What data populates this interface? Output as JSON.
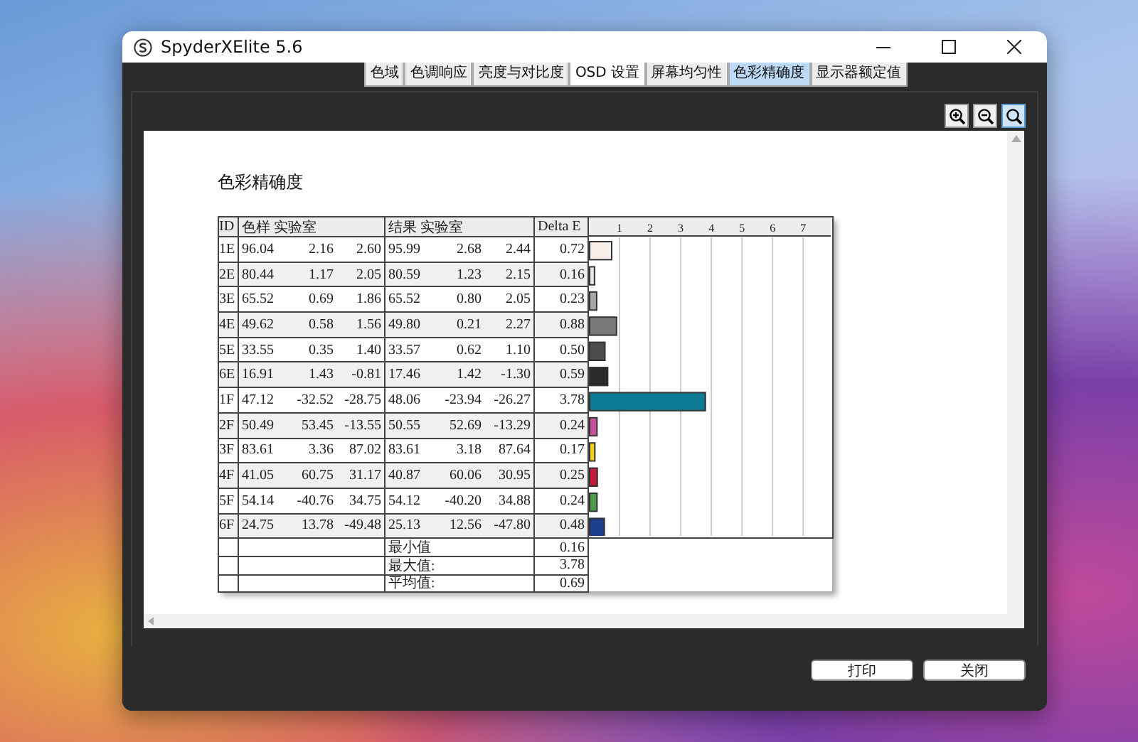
{
  "window": {
    "title": "SpyderXElite 5.6"
  },
  "tabs": [
    {
      "label": "色域",
      "selected": false,
      "hovered": false
    },
    {
      "label": "色调响应",
      "selected": false,
      "hovered": false
    },
    {
      "label": "亮度与对比度",
      "selected": false,
      "hovered": false
    },
    {
      "label": "OSD 设置",
      "selected": false,
      "hovered": true
    },
    {
      "label": "屏幕均匀性",
      "selected": false,
      "hovered": false
    },
    {
      "label": "色彩精确度",
      "selected": true,
      "hovered": false
    },
    {
      "label": "显示器额定值",
      "selected": false,
      "hovered": false
    }
  ],
  "zoom_tools": [
    {
      "kind": "zoom-in",
      "selected": false
    },
    {
      "kind": "zoom-out",
      "selected": false
    },
    {
      "kind": "zoom-fit",
      "selected": true
    }
  ],
  "report": {
    "title": "色彩精确度",
    "columns": [
      "ID",
      "色样 实验室",
      "结果 实验室",
      "Delta E"
    ],
    "rows": [
      {
        "id": "1E",
        "sample": [
          "96.04",
          "2.16",
          "2.60"
        ],
        "result": [
          "95.99",
          "2.68",
          "2.44"
        ],
        "delta_e": "0.72",
        "color": "#f8eeea"
      },
      {
        "id": "2E",
        "sample": [
          "80.44",
          "1.17",
          "2.05"
        ],
        "result": [
          "80.59",
          "1.23",
          "2.15"
        ],
        "delta_e": "0.16",
        "color": "#e6e6e6"
      },
      {
        "id": "3E",
        "sample": [
          "65.52",
          "0.69",
          "1.86"
        ],
        "result": [
          "65.52",
          "0.80",
          "2.05"
        ],
        "delta_e": "0.23",
        "color": "#a9a7a4"
      },
      {
        "id": "4E",
        "sample": [
          "49.62",
          "0.58",
          "1.56"
        ],
        "result": [
          "49.80",
          "0.21",
          "2.27"
        ],
        "delta_e": "0.88",
        "color": "#7a7977"
      },
      {
        "id": "5E",
        "sample": [
          "33.55",
          "0.35",
          "1.40"
        ],
        "result": [
          "33.57",
          "0.62",
          "1.10"
        ],
        "delta_e": "0.50",
        "color": "#4d4c4c"
      },
      {
        "id": "6E",
        "sample": [
          "16.91",
          "1.43",
          "-0.81"
        ],
        "result": [
          "17.46",
          "1.42",
          "-1.30"
        ],
        "delta_e": "0.59",
        "color": "#2b2b2c"
      },
      {
        "id": "1F",
        "sample": [
          "47.12",
          "-32.52",
          "-28.75"
        ],
        "result": [
          "48.06",
          "-23.94",
          "-26.27"
        ],
        "delta_e": "3.78",
        "color": "#0f7c96"
      },
      {
        "id": "2F",
        "sample": [
          "50.49",
          "53.45",
          "-13.55"
        ],
        "result": [
          "50.55",
          "52.69",
          "-13.29"
        ],
        "delta_e": "0.24",
        "color": "#c94f9c"
      },
      {
        "id": "3F",
        "sample": [
          "83.61",
          "3.36",
          "87.02"
        ],
        "result": [
          "83.61",
          "3.18",
          "87.64"
        ],
        "delta_e": "0.17",
        "color": "#f2d21e"
      },
      {
        "id": "4F",
        "sample": [
          "41.05",
          "60.75",
          "31.17"
        ],
        "result": [
          "40.87",
          "60.06",
          "30.95"
        ],
        "delta_e": "0.25",
        "color": "#c21c38"
      },
      {
        "id": "5F",
        "sample": [
          "54.14",
          "-40.76",
          "34.75"
        ],
        "result": [
          "54.12",
          "-40.20",
          "34.88"
        ],
        "delta_e": "0.24",
        "color": "#4e9a4a"
      },
      {
        "id": "6F",
        "sample": [
          "24.75",
          "13.78",
          "-49.48"
        ],
        "result": [
          "25.13",
          "12.56",
          "-47.80"
        ],
        "delta_e": "0.48",
        "color": "#1c3f8c"
      }
    ],
    "summary": [
      {
        "label": "最小值",
        "value": "0.16"
      },
      {
        "label": "最大值:",
        "value": "3.78"
      },
      {
        "label": "平均值:",
        "value": "0.69"
      }
    ],
    "chart_data": {
      "type": "bar",
      "orientation": "horizontal",
      "grid": true,
      "series": [
        {
          "values": [
            0.72,
            0.16,
            0.23,
            0.88,
            0.5,
            0.59,
            3.78,
            0.24,
            0.17,
            0.25,
            0.24,
            0.48
          ]
        }
      ],
      "xlim": [
        0,
        7.9
      ],
      "xticks": [
        {
          "value": 1,
          "label": "1"
        },
        {
          "value": 2,
          "label": "2"
        },
        {
          "value": 3,
          "label": "3"
        },
        {
          "value": 4,
          "label": "4"
        },
        {
          "value": 5,
          "label": "5"
        },
        {
          "value": 6,
          "label": "6"
        },
        {
          "value": 7,
          "label": "7"
        }
      ]
    }
  },
  "buttons": [
    "打印",
    "关闭"
  ]
}
